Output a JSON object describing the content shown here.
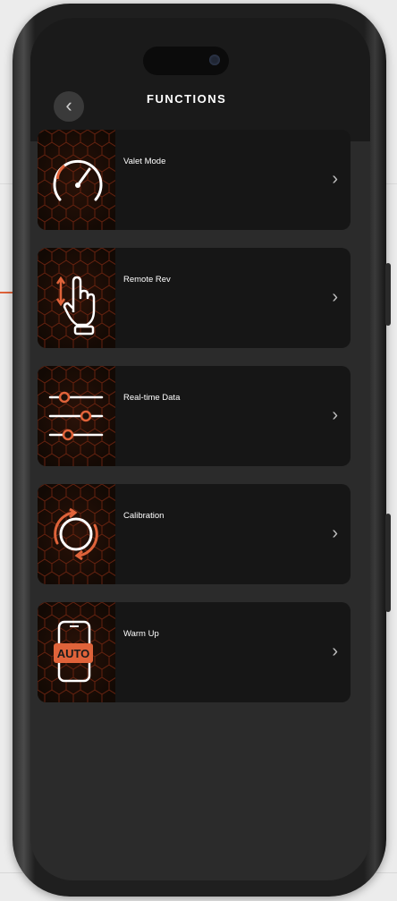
{
  "header": {
    "title": "FUNCTIONS",
    "back_icon": "chevron-left-icon"
  },
  "functions": [
    {
      "label": "Valet Mode",
      "icon": "speedometer-icon"
    },
    {
      "label": "Remote Rev",
      "icon": "hand-tap-icon"
    },
    {
      "label": "Real-time Data",
      "icon": "sliders-icon"
    },
    {
      "label": "Calibration",
      "icon": "calibration-icon"
    },
    {
      "label": "Warm Up",
      "icon": "auto-phone-icon"
    }
  ],
  "colors": {
    "accent": "#e0633a",
    "card": "#161616",
    "screen": "#2b2b2b",
    "header": "#1a1a1a"
  }
}
